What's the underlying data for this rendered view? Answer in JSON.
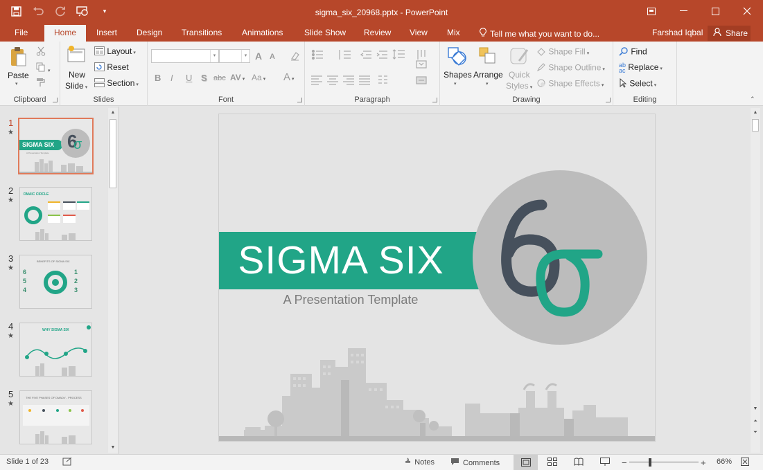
{
  "window": {
    "title": "sigma_six_20968.pptx - PowerPoint",
    "controls": [
      "ribbon-display-options-icon",
      "minimize-icon",
      "maximize-icon",
      "close-icon"
    ]
  },
  "qat": [
    "save-icon",
    "undo-icon",
    "redo-icon",
    "present-icon",
    "customize-icon"
  ],
  "tabs": {
    "items": [
      "File",
      "Home",
      "Insert",
      "Design",
      "Transitions",
      "Animations",
      "Slide Show",
      "Review",
      "View",
      "Mix"
    ],
    "active": "Home",
    "tell_me": "Tell me what you want to do...",
    "user": "Farshad Iqbal",
    "share": "Share"
  },
  "ribbon": {
    "clipboard": {
      "label": "Clipboard",
      "paste": "Paste"
    },
    "slides": {
      "label": "Slides",
      "new_slide_1": "New",
      "new_slide_2": "Slide",
      "layout": "Layout",
      "reset": "Reset",
      "section": "Section"
    },
    "font": {
      "label": "Font",
      "bold": "B",
      "italic": "I",
      "underline": "U",
      "shadow": "S",
      "strike": "abc",
      "spacing": "AV",
      "case": "Aa",
      "color": "A",
      "grow": "A",
      "shrink": "A"
    },
    "paragraph": {
      "label": "Paragraph"
    },
    "drawing": {
      "label": "Drawing",
      "shapes": "Shapes",
      "arrange": "Arrange",
      "quick_styles_1": "Quick",
      "quick_styles_2": "Styles",
      "shape_fill": "Shape Fill",
      "shape_outline": "Shape Outline",
      "shape_effects": "Shape Effects"
    },
    "editing": {
      "label": "Editing",
      "find": "Find",
      "replace": "Replace",
      "select": "Select"
    }
  },
  "thumbnails": [
    {
      "num": "1",
      "title": "SIGMA SIX",
      "sub": "A Presentation Template"
    },
    {
      "num": "2",
      "title": "DMAIC CIRCLE"
    },
    {
      "num": "3",
      "title": "BENEFITS OF SIGMA SIX",
      "left_nums": [
        "6",
        "5",
        "4"
      ],
      "right_nums": [
        "1",
        "2",
        "3"
      ]
    },
    {
      "num": "4",
      "title": "WHY SIGMA SIX"
    },
    {
      "num": "5",
      "title": "THE FIVE PHASES OF DMADV - PROCESS"
    }
  ],
  "slide": {
    "title": "SIGMA SIX",
    "subtitle": "A Presentation Template",
    "six": "6",
    "sigma": "σ",
    "colors": {
      "teal": "#21a587",
      "dark": "#46505c",
      "circle": "#bcbcbc"
    }
  },
  "status": {
    "slide_info": "Slide 1 of 23",
    "notes": "Notes",
    "comments": "Comments",
    "zoom": "66%"
  }
}
